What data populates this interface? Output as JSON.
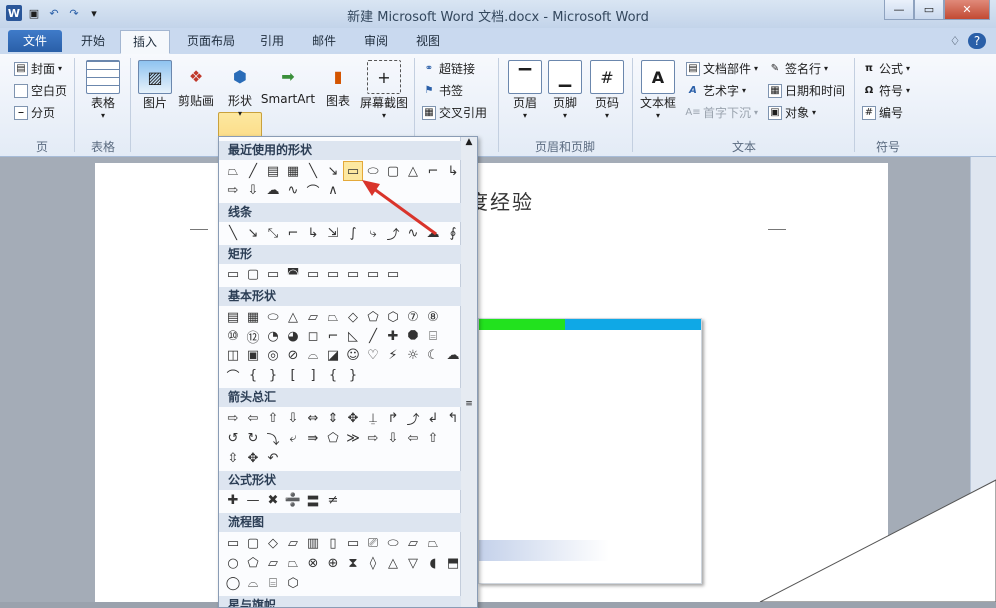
{
  "window": {
    "title": "新建 Microsoft Word 文档.docx - Microsoft Word"
  },
  "qat": {
    "icons": [
      "word-logo",
      "save-icon",
      "undo-icon",
      "redo-icon",
      "customize-qat-icon"
    ],
    "word_glyph": "W",
    "save_glyph": "▣",
    "undo_glyph": "↶",
    "redo_glyph": "↷",
    "custom_glyph": "▾"
  },
  "window_controls": {
    "minimize": "—",
    "maximize": "▭",
    "close": "✕"
  },
  "tabs": [
    "文件",
    "开始",
    "插入",
    "页面布局",
    "引用",
    "邮件",
    "审阅",
    "视图"
  ],
  "tab_help": {
    "caret": "♢",
    "help": "?"
  },
  "ribbon": {
    "page_group": {
      "cover": "封面",
      "blank": "空白页",
      "break": "分页",
      "label": "页"
    },
    "table_group": {
      "table": "表格",
      "label": "表格"
    },
    "illustrations": {
      "picture": "图片",
      "clipart": "剪贴画",
      "shapes": "形状",
      "smartart": "SmartArt",
      "chart": "图表",
      "screenshot": "屏幕截图"
    },
    "links": {
      "hyperlink": "超链接",
      "bookmark": "书签",
      "crossref": "交叉引用"
    },
    "header_footer": {
      "header": "页眉",
      "footer": "页脚",
      "pagenum": "页码",
      "label": "页眉和页脚"
    },
    "text": {
      "textbox": "文本框",
      "parts": "文档部件",
      "wordart": "艺术字",
      "dropcap": "首字下沉",
      "signature": "签名行",
      "datetime": "日期和时间",
      "object": "对象",
      "label": "文本"
    },
    "symbols": {
      "equation": "公式",
      "symbol": "符号",
      "number": "编号",
      "label": "符号"
    }
  },
  "shapes_menu": {
    "sections": [
      "最近使用的形状",
      "线条",
      "矩形",
      "基本形状",
      "箭头总汇",
      "公式形状",
      "流程图",
      "星与旗帜"
    ],
    "recent_row1": [
      "⏢",
      "╱",
      "▤",
      "▦",
      "╲",
      "↘",
      "▭",
      "⬭",
      "▢",
      "△",
      "⌐",
      "↳"
    ],
    "recent_row2": [
      "⇨",
      "⇩",
      "☁",
      "∿",
      "⌒",
      "∧"
    ],
    "lines": [
      "╲",
      "↘",
      "⤡",
      "⌐",
      "↳",
      "⇲",
      "∫",
      "⤷",
      "⤴",
      "∿",
      "☁",
      "∮"
    ],
    "rects": [
      "▭",
      "▢",
      "▭",
      "◚",
      "▭",
      "▭",
      "▭",
      "▭",
      "▭"
    ],
    "basic1": [
      "▤",
      "▦",
      "⬭",
      "△",
      "▱",
      "⏢",
      "◇",
      "⬠",
      "⬡",
      "⑦",
      "⑧"
    ],
    "basic2": [
      "⑩",
      "⑫",
      "◔",
      "◕",
      "◻",
      "⌐",
      "◺",
      "╱",
      "✚",
      "⯃",
      "⌸"
    ],
    "basic3": [
      "◫",
      "▣",
      "◎",
      "⊘",
      "⌓",
      "◪",
      "☺",
      "♡",
      "⚡",
      "☼",
      "☾",
      "☁"
    ],
    "basic4": [
      "⌒",
      "{",
      "}",
      "[",
      "]",
      "{",
      "}"
    ],
    "arrows1": [
      "⇨",
      "⇦",
      "⇧",
      "⇩",
      "⇔",
      "⇕",
      "✥",
      "⍊",
      "↱",
      "⤴",
      "↲",
      "↰"
    ],
    "arrows2": [
      "↺",
      "↻",
      "⤵",
      "⤶",
      "⇛",
      "⬠",
      "≫",
      "⇨",
      "⇩",
      "⇦",
      "⇧"
    ],
    "arrows3": [
      "⇳",
      "✥",
      "↶"
    ],
    "equations": [
      "✚",
      "—",
      "✖",
      "➗",
      "〓",
      "≠"
    ],
    "flow1": [
      "▭",
      "▢",
      "◇",
      "▱",
      "▥",
      "▯",
      "▭",
      "⎚",
      "⬭",
      "⏥",
      "⏢"
    ],
    "flow2": [
      "○",
      "⬠",
      "▱",
      "⏢",
      "⊗",
      "⊕",
      "⧗",
      "◊",
      "△",
      "▽",
      "◖",
      "⬒"
    ],
    "flow3": [
      "◯",
      "⌓",
      "⌸",
      "⬡"
    ]
  },
  "document": {
    "heading_visible": "度经验",
    "colors": {
      "green": "#22e21e",
      "blue": "#0fa8e6"
    }
  }
}
